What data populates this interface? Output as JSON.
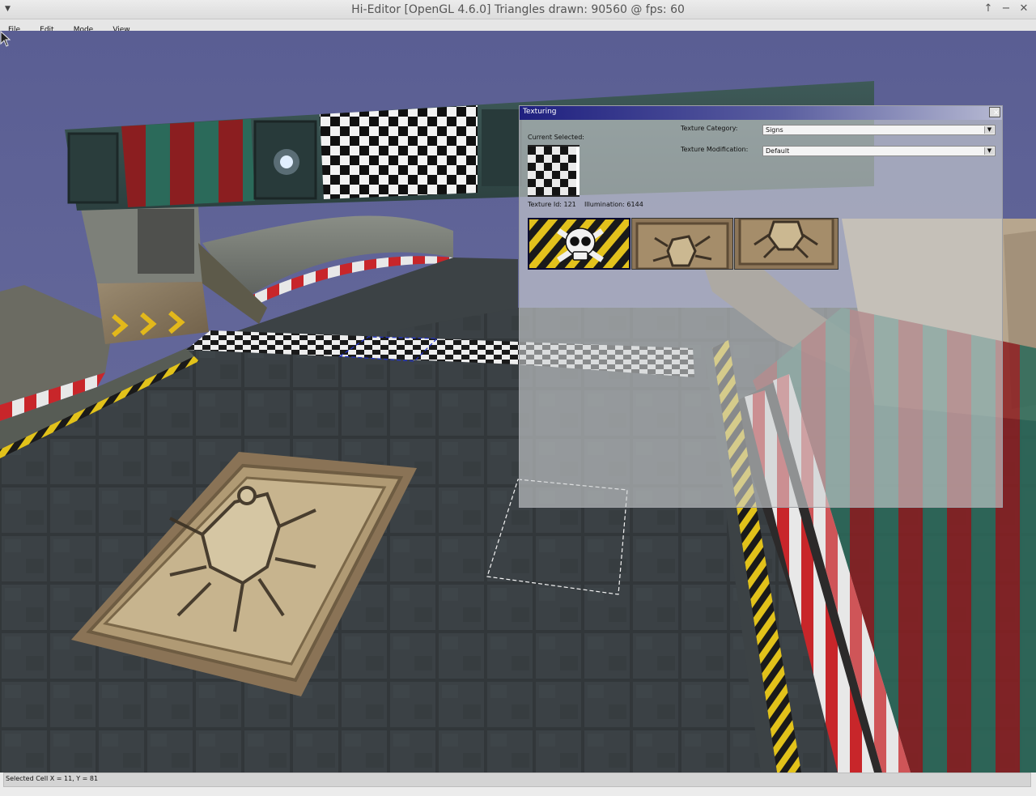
{
  "window": {
    "title": "Hi-Editor [OpenGL 4.6.0] Triangles drawn: 90560 @ fps: 60",
    "menu_icon": "triangle-down-icon",
    "buttons": [
      "maximize-icon",
      "minimize-icon",
      "close-icon"
    ]
  },
  "menubar": {
    "items": [
      "File",
      "Edit",
      "Mode",
      "View"
    ]
  },
  "dialog": {
    "title": "Texturing",
    "current_selected_label": "Current Selected:",
    "texture_id_label": "Texture Id: 121",
    "illumination_label": "Illumination: 6144",
    "category_label": "Texture Category:",
    "category_value": "Signs",
    "modification_label": "Texture Modification:",
    "modification_value": "Default",
    "thumbnails": [
      "skull-hazard-sign-icon",
      "spider-plate-sign-icon",
      "spider-plate-sign-icon"
    ]
  },
  "statusbar": {
    "text": "Selected Cell X = 11, Y = 81"
  },
  "colors": {
    "sky": "#5f6396",
    "road": "#3f4548",
    "dialog_title_start": "#1f2080",
    "dialog_title_end": "#b6b9d2"
  }
}
